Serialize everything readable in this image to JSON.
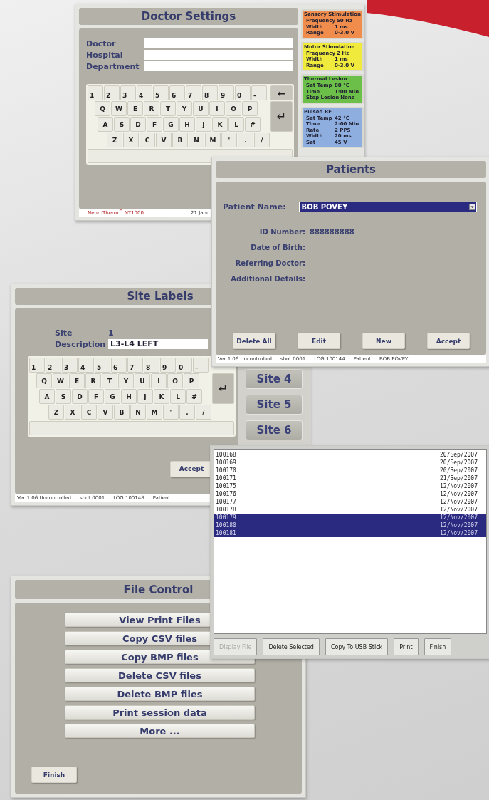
{
  "doctor_settings": {
    "title": "Doctor Settings",
    "fields": [
      {
        "label": "Doctor"
      },
      {
        "label": "Hospital"
      },
      {
        "label": "Department"
      }
    ],
    "keyboard": {
      "rows": [
        [
          "1",
          "2",
          "3",
          "4",
          "5",
          "6",
          "7",
          "8",
          "9",
          "0",
          "–"
        ],
        [
          "Q",
          "W",
          "E",
          "R",
          "T",
          "Y",
          "U",
          "I",
          "O",
          "P"
        ],
        [
          "A",
          "S",
          "D",
          "F",
          "G",
          "H",
          "J",
          "K",
          "L",
          "#"
        ],
        [
          "Z",
          "X",
          "C",
          "V",
          "B",
          "N",
          "M",
          "'",
          ".",
          "/"
        ]
      ],
      "backspace": "←",
      "enter": "↵"
    },
    "footer": {
      "brand": "NeuroTherm$^{™}$ NT1000",
      "date": "21 Janu"
    },
    "panels": [
      {
        "title": "Sensory Stimulation",
        "color": "#f08c4c",
        "rows": [
          {
            "label": "Frequency",
            "value": "50 Hz"
          },
          {
            "label": "Width",
            "value": "1 ms"
          },
          {
            "label": "Range",
            "value": "0-3.0 V"
          }
        ]
      },
      {
        "title": "Motor Stimulation",
        "color": "#f0ea3c",
        "rows": [
          {
            "label": "Frequency",
            "value": "2 Hz"
          },
          {
            "label": "Width",
            "value": "1 ms"
          },
          {
            "label": "Range",
            "value": "0-3.0 V"
          }
        ]
      },
      {
        "title": "Thermal Lesion",
        "color": "#6cbf48",
        "rows": [
          {
            "label": "Set Temp",
            "value": "80 °C"
          },
          {
            "label": "Time",
            "value": "1:00 Min"
          },
          {
            "label": "Step Lesion",
            "value": "None"
          }
        ]
      },
      {
        "title": "Pulsed RF",
        "color": "#8eaee0",
        "rows": [
          {
            "label": "Set Temp",
            "value": "42 °C"
          },
          {
            "label": "Time",
            "value": "2:00 Min"
          },
          {
            "label": "Rate",
            "value": "2 PPS"
          },
          {
            "label": "Width",
            "value": "20 ms"
          },
          {
            "label": "Set",
            "value": "45 V"
          }
        ]
      }
    ]
  },
  "patients": {
    "title": "Patients",
    "patient_name": {
      "label": "Patient Name:",
      "value": "BOB POVEY"
    },
    "details": [
      {
        "label": "ID Number:",
        "value": "888888888"
      },
      {
        "label": "Date of Birth:"
      },
      {
        "label": "Referring Doctor:"
      },
      {
        "label": "Additional Details:"
      }
    ],
    "buttons": [
      "Delete All",
      "Edit",
      "New",
      "Accept"
    ],
    "status_bar": [
      "Ver 1.06 Uncontrolled",
      "shot 0001",
      "LOG 100144",
      "Patient",
      "BOB POVEY"
    ]
  },
  "site_labels": {
    "title": "Site Labels",
    "site": {
      "label": "Site",
      "value": "1"
    },
    "description": {
      "label": "Description",
      "value": "L3-L4 LEFT"
    },
    "keyboard": {
      "rows": [
        [
          "1",
          "2",
          "3",
          "4",
          "5",
          "6",
          "7",
          "8",
          "9",
          "0",
          "–"
        ],
        [
          "Q",
          "W",
          "E",
          "R",
          "T",
          "Y",
          "U",
          "I",
          "O",
          "P"
        ],
        [
          "A",
          "S",
          "D",
          "F",
          "G",
          "H",
          "J",
          "K",
          "L",
          "#"
        ],
        [
          "Z",
          "X",
          "C",
          "V",
          "B",
          "N",
          "M",
          "'",
          ".",
          "/"
        ]
      ],
      "enter": "↵"
    },
    "buttons": [
      "Accept"
    ],
    "status_bar": [
      "Ver 1.06 Uncontrolled",
      "shot 0001",
      "LOG 100148",
      "Patient"
    ]
  },
  "site_buttons": [
    "Site 4",
    "Site 5",
    "Site 6"
  ],
  "file_list": {
    "rows": [
      {
        "id": "100168",
        "date": "20/Sep/2007",
        "selected": false
      },
      {
        "id": "100169",
        "date": "20/Sep/2007",
        "selected": false
      },
      {
        "id": "100170",
        "date": "20/Sep/2007",
        "selected": false
      },
      {
        "id": "100171",
        "date": "21/Sep/2007",
        "selected": false
      },
      {
        "id": "100175",
        "date": "12/Nov/2007",
        "selected": false
      },
      {
        "id": "100176",
        "date": "12/Nov/2007",
        "selected": false
      },
      {
        "id": "100177",
        "date": "12/Nov/2007",
        "selected": false
      },
      {
        "id": "100178",
        "date": "12/Nov/2007",
        "selected": false
      },
      {
        "id": "100179",
        "date": "12/Nov/2007",
        "selected": true
      },
      {
        "id": "100180",
        "date": "12/Nov/2007",
        "selected": true
      },
      {
        "id": "100181",
        "date": "12/Nov/2007",
        "selected": true
      }
    ],
    "buttons": [
      {
        "label": "Display File",
        "disabled": true
      },
      {
        "label": "Delete Selected",
        "disabled": false
      },
      {
        "label": "Copy To USB Stick",
        "disabled": false
      },
      {
        "label": "Print",
        "disabled": false
      },
      {
        "label": "Finish",
        "disabled": false
      }
    ]
  },
  "file_control": {
    "title": "File Control",
    "actions": [
      "View Print Files",
      "Copy CSV files",
      "Copy BMP files",
      "Delete CSV files",
      "Delete BMP files",
      "Print session data",
      "More ..."
    ],
    "finish": "Finish"
  }
}
